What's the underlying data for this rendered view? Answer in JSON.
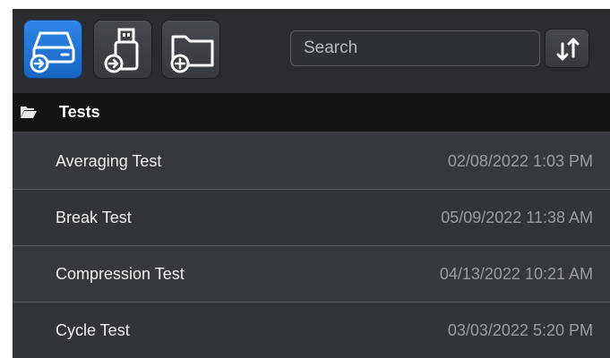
{
  "toolbar": {
    "buttons": [
      {
        "name": "drive-import",
        "icon": "hard-drive-import-icon",
        "active": true
      },
      {
        "name": "usb-import",
        "icon": "usb-import-icon",
        "active": false
      },
      {
        "name": "new-folder",
        "icon": "folder-add-icon",
        "active": false
      }
    ],
    "search_placeholder": "Search",
    "search_value": "",
    "sort_icon": "sort-arrows-icon"
  },
  "folder": {
    "icon": "folder-open-icon",
    "label": "Tests"
  },
  "tests": [
    {
      "name": "Averaging Test",
      "date": "02/08/2022 1:03 PM"
    },
    {
      "name": "Break Test",
      "date": "05/09/2022 11:38 AM"
    },
    {
      "name": "Compression Test",
      "date": "04/13/2022 10:21 AM"
    },
    {
      "name": "Cycle Test",
      "date": "03/03/2022 5:20 PM"
    }
  ],
  "colors": {
    "accent": "#1f78d8",
    "panel": "#2c2f33",
    "header": "#141517"
  }
}
